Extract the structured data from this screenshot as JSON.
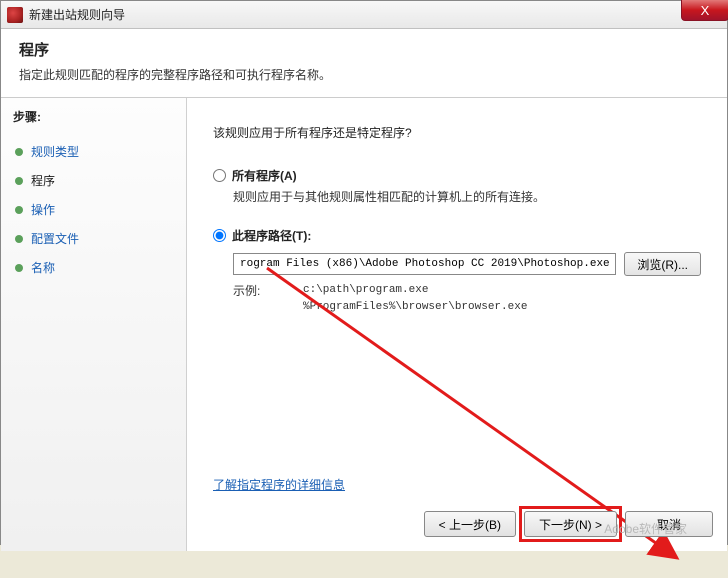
{
  "titlebar": {
    "title": "新建出站规则向导",
    "close_label": "X"
  },
  "header": {
    "title": "程序",
    "subtitle": "指定此规则匹配的程序的完整程序路径和可执行程序名称。"
  },
  "sidebar": {
    "title": "步骤:",
    "steps": [
      {
        "label": "规则类型"
      },
      {
        "label": "程序"
      },
      {
        "label": "操作"
      },
      {
        "label": "配置文件"
      },
      {
        "label": "名称"
      }
    ]
  },
  "main": {
    "question": "该规则应用于所有程序还是特定程序?",
    "option_all": {
      "label": "所有程序(A)",
      "desc": "规则应用于与其他规则属性相匹配的计算机上的所有连接。"
    },
    "option_path": {
      "label": "此程序路径(T):",
      "value": "rogram Files (x86)\\Adobe Photoshop CC 2019\\Photoshop.exe",
      "browse": "浏览(R)..."
    },
    "example": {
      "label": "示例:",
      "line1": "c:\\path\\program.exe",
      "line2": "%ProgramFiles%\\browser\\browser.exe"
    },
    "learn_more": "了解指定程序的详细信息"
  },
  "buttons": {
    "back": "< 上一步(B)",
    "next": "下一步(N) >",
    "cancel": "取消"
  },
  "watermark": "Adobe软件管家"
}
